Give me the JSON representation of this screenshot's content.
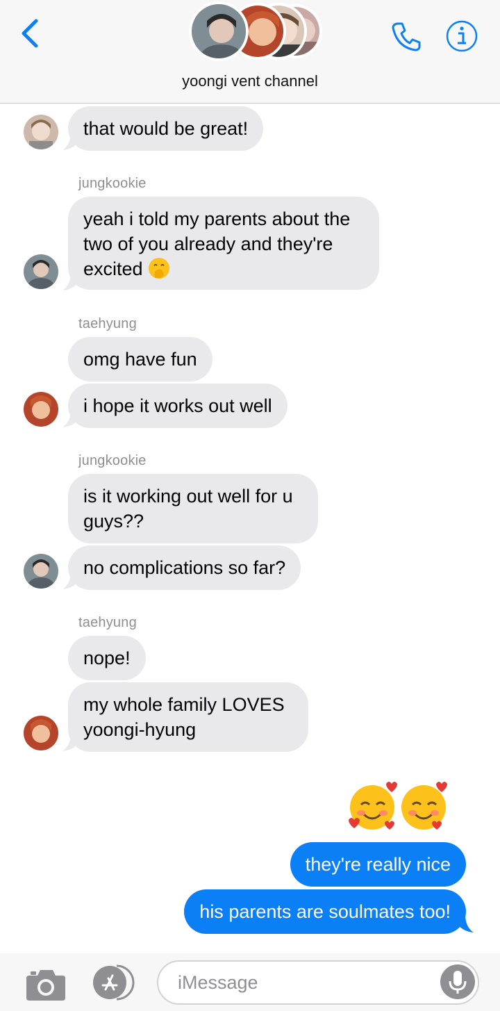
{
  "header": {
    "group_name": "yoongi vent channel",
    "back_icon": "chevron-left-icon",
    "call_icon": "phone-icon",
    "info_icon": "info-icon"
  },
  "messages": {
    "m1": {
      "text": "that would be great!"
    },
    "jk1": {
      "sender": "jungkookie",
      "lines": [
        "yeah i told my parents about the",
        "two of you already and they're",
        "excited"
      ]
    },
    "th1": {
      "sender": "taehyung",
      "b1": "omg have fun",
      "b2": "i hope it works out well"
    },
    "jk2": {
      "sender": "jungkookie",
      "b1_lines": [
        "is it working out well for u",
        "guys??"
      ],
      "b2": "no complications so far?"
    },
    "th2": {
      "sender": "taehyung",
      "b1": "nope!",
      "b2_lines": [
        "my whole family LOVES",
        "yoongi-hyung"
      ]
    },
    "me": {
      "emoji": "smiling-face-with-hearts x2",
      "b1": "they're really nice",
      "b2": "his parents are soulmates too!"
    }
  },
  "input": {
    "placeholder": "iMessage"
  },
  "colors": {
    "accent": "#0b7ff5",
    "incoming_bubble": "#e9e9eb",
    "header_bg": "#f7f7f7",
    "meta_gray": "#8e8e93"
  }
}
